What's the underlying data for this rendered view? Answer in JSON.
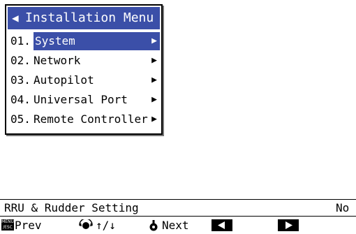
{
  "menu": {
    "title": "Installation Menu",
    "items": [
      {
        "num": "01.",
        "label": "System"
      },
      {
        "num": "02.",
        "label": "Network"
      },
      {
        "num": "03.",
        "label": "Autopilot"
      },
      {
        "num": "04.",
        "label": "Universal Port"
      },
      {
        "num": "05.",
        "label": "Remote Controller"
      }
    ],
    "selected_index": 0
  },
  "status": {
    "left_text": "RRU & Rudder Setting",
    "right_text": "No"
  },
  "footer": {
    "menu_key_line1": "MENU",
    "menu_key_line2": "/ESC",
    "prev_label": "Prev",
    "scroll_label": "↑/↓",
    "next_label": "Next"
  },
  "colors": {
    "highlight": "#3b4fa8"
  }
}
